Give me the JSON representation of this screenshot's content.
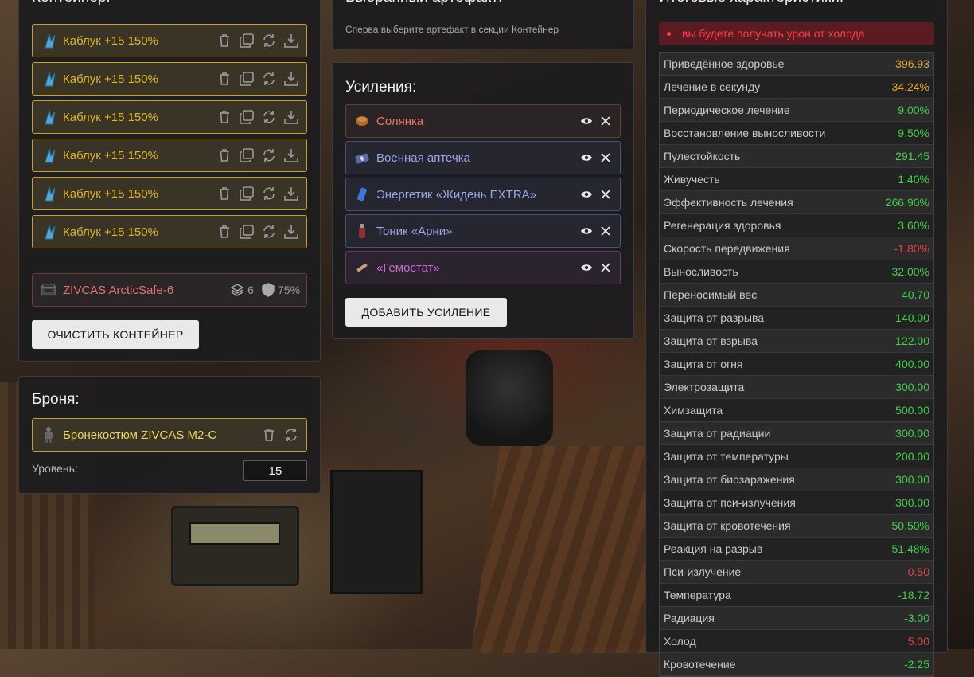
{
  "container": {
    "title": "Контейнер:",
    "artifacts": [
      {
        "label": "Каблук +15 150%"
      },
      {
        "label": "Каблук +15 150%"
      },
      {
        "label": "Каблук +15 150%"
      },
      {
        "label": "Каблук +15 150%"
      },
      {
        "label": "Каблук +15 150%"
      },
      {
        "label": "Каблук +15 150%"
      }
    ],
    "case": {
      "label": "ZIVCAS ArcticSafe-6",
      "slots": "6",
      "protection": "75%"
    },
    "clear_button": "ОЧИСТИТЬ КОНТЕЙНЕР"
  },
  "armor": {
    "title": "Броня:",
    "item": "Бронекостюм ZIVCAS M2-C",
    "level_label": "Уровень:",
    "level_value": "15"
  },
  "selected": {
    "title": "Выбранный артефакт:",
    "hint": "Сперва выберите артефакт в секции Контейнер"
  },
  "boosts": {
    "title": "Усиления:",
    "items": [
      {
        "label": "Солянка",
        "color": "#e87a6a",
        "border": "#6b3c3c",
        "bg": "#2b2425",
        "icon": "bowl-icon"
      },
      {
        "label": "Военная аптечка",
        "color": "#9ea6e8",
        "border": "#4a4f7e",
        "bg": "#25262f",
        "icon": "medkit-icon"
      },
      {
        "label": "Энергетик «Жидень EXTRA»",
        "color": "#9ea6e8",
        "border": "#4a4f7e",
        "bg": "#25262f",
        "icon": "can-icon"
      },
      {
        "label": "Тоник «Арни»",
        "color": "#9ea6e8",
        "border": "#4a4f7e",
        "bg": "#25262f",
        "icon": "bottle-icon"
      },
      {
        "label": "«Гемостат»",
        "color": "#d06ad0",
        "border": "#6a3a6a",
        "bg": "#2b2330",
        "icon": "syringe-icon"
      }
    ],
    "add_button": "ДОБАВИТЬ УСИЛЕНИЕ"
  },
  "stats": {
    "title": "Итоговые характеристики:",
    "warning": "вы будете получать урон от холода",
    "colors": {
      "orange": "#e8a524",
      "green": "#3fd04a",
      "red": "#e8413f"
    },
    "rows": [
      {
        "name": "Приведённое здоровье",
        "value": "396.93",
        "tone": "orange"
      },
      {
        "name": "Лечение в секунду",
        "value": "34.24%",
        "tone": "orange"
      },
      {
        "name": "Периодическое лечение",
        "value": "9.00%",
        "tone": "green"
      },
      {
        "name": "Восстановление выносливости",
        "value": "9.50%",
        "tone": "green"
      },
      {
        "name": "Пулестойкость",
        "value": "291.45",
        "tone": "green"
      },
      {
        "name": "Живучесть",
        "value": "1.40%",
        "tone": "green"
      },
      {
        "name": "Эффективность лечения",
        "value": "266.90%",
        "tone": "green"
      },
      {
        "name": "Регенерация здоровья",
        "value": "3.60%",
        "tone": "green"
      },
      {
        "name": "Скорость передвижения",
        "value": "-1.80%",
        "tone": "red"
      },
      {
        "name": "Выносливость",
        "value": "32.00%",
        "tone": "green"
      },
      {
        "name": "Переносимый вес",
        "value": "40.70",
        "tone": "green"
      },
      {
        "name": "Защита от разрыва",
        "value": "140.00",
        "tone": "green"
      },
      {
        "name": "Защита от взрыва",
        "value": "122.00",
        "tone": "green"
      },
      {
        "name": "Защита от огня",
        "value": "400.00",
        "tone": "green"
      },
      {
        "name": "Электрозащита",
        "value": "300.00",
        "tone": "green"
      },
      {
        "name": "Химзащита",
        "value": "500.00",
        "tone": "green"
      },
      {
        "name": "Защита от радиации",
        "value": "300.00",
        "tone": "green"
      },
      {
        "name": "Защита от температуры",
        "value": "200.00",
        "tone": "green"
      },
      {
        "name": "Защита от биозаражения",
        "value": "300.00",
        "tone": "green"
      },
      {
        "name": "Защита от пси-излучения",
        "value": "300.00",
        "tone": "green"
      },
      {
        "name": "Защита от кровотечения",
        "value": "50.50%",
        "tone": "green"
      },
      {
        "name": "Реакция на разрыв",
        "value": "51.48%",
        "tone": "green"
      },
      {
        "name": "Пси-излучение",
        "value": "0.50",
        "tone": "red"
      },
      {
        "name": "Температура",
        "value": "-18.72",
        "tone": "green"
      },
      {
        "name": "Радиация",
        "value": "-3.00",
        "tone": "green"
      },
      {
        "name": "Холод",
        "value": "5.00",
        "tone": "red"
      },
      {
        "name": "Кровотечение",
        "value": "-2.25",
        "tone": "green"
      }
    ]
  }
}
